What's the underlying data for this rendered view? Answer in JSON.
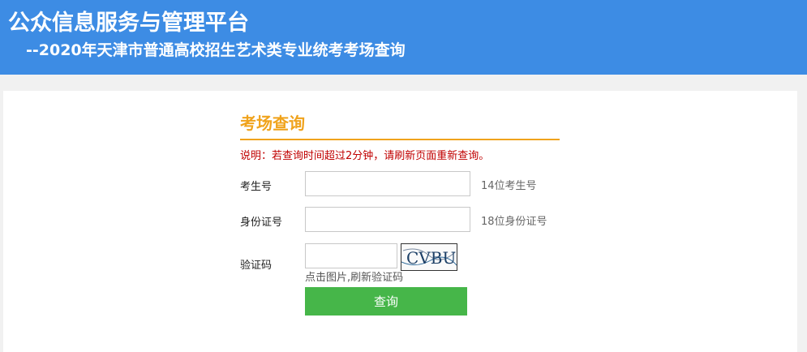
{
  "header": {
    "title": "公众信息服务与管理平台",
    "subtitle": "--2020年天津市普通高校招生艺术类专业统考考场查询"
  },
  "form": {
    "heading": "考场查询",
    "note": "说明：若查询时间超过2分钟，请刷新页面重新查询。",
    "fields": [
      {
        "label": "考生号",
        "value": "",
        "hint": "14位考生号"
      },
      {
        "label": "身份证号",
        "value": "",
        "hint": "18位身份证号"
      },
      {
        "label": "验证码",
        "value": "",
        "hint": ""
      }
    ],
    "captcha": {
      "text": "CVBU",
      "refresh_hint": "点击图片,刷新验证码"
    },
    "submit_label": "查询"
  },
  "colors": {
    "header_bg": "#3d8ce4",
    "accent": "#f0a31c",
    "note": "#c00000",
    "button": "#46b649"
  }
}
